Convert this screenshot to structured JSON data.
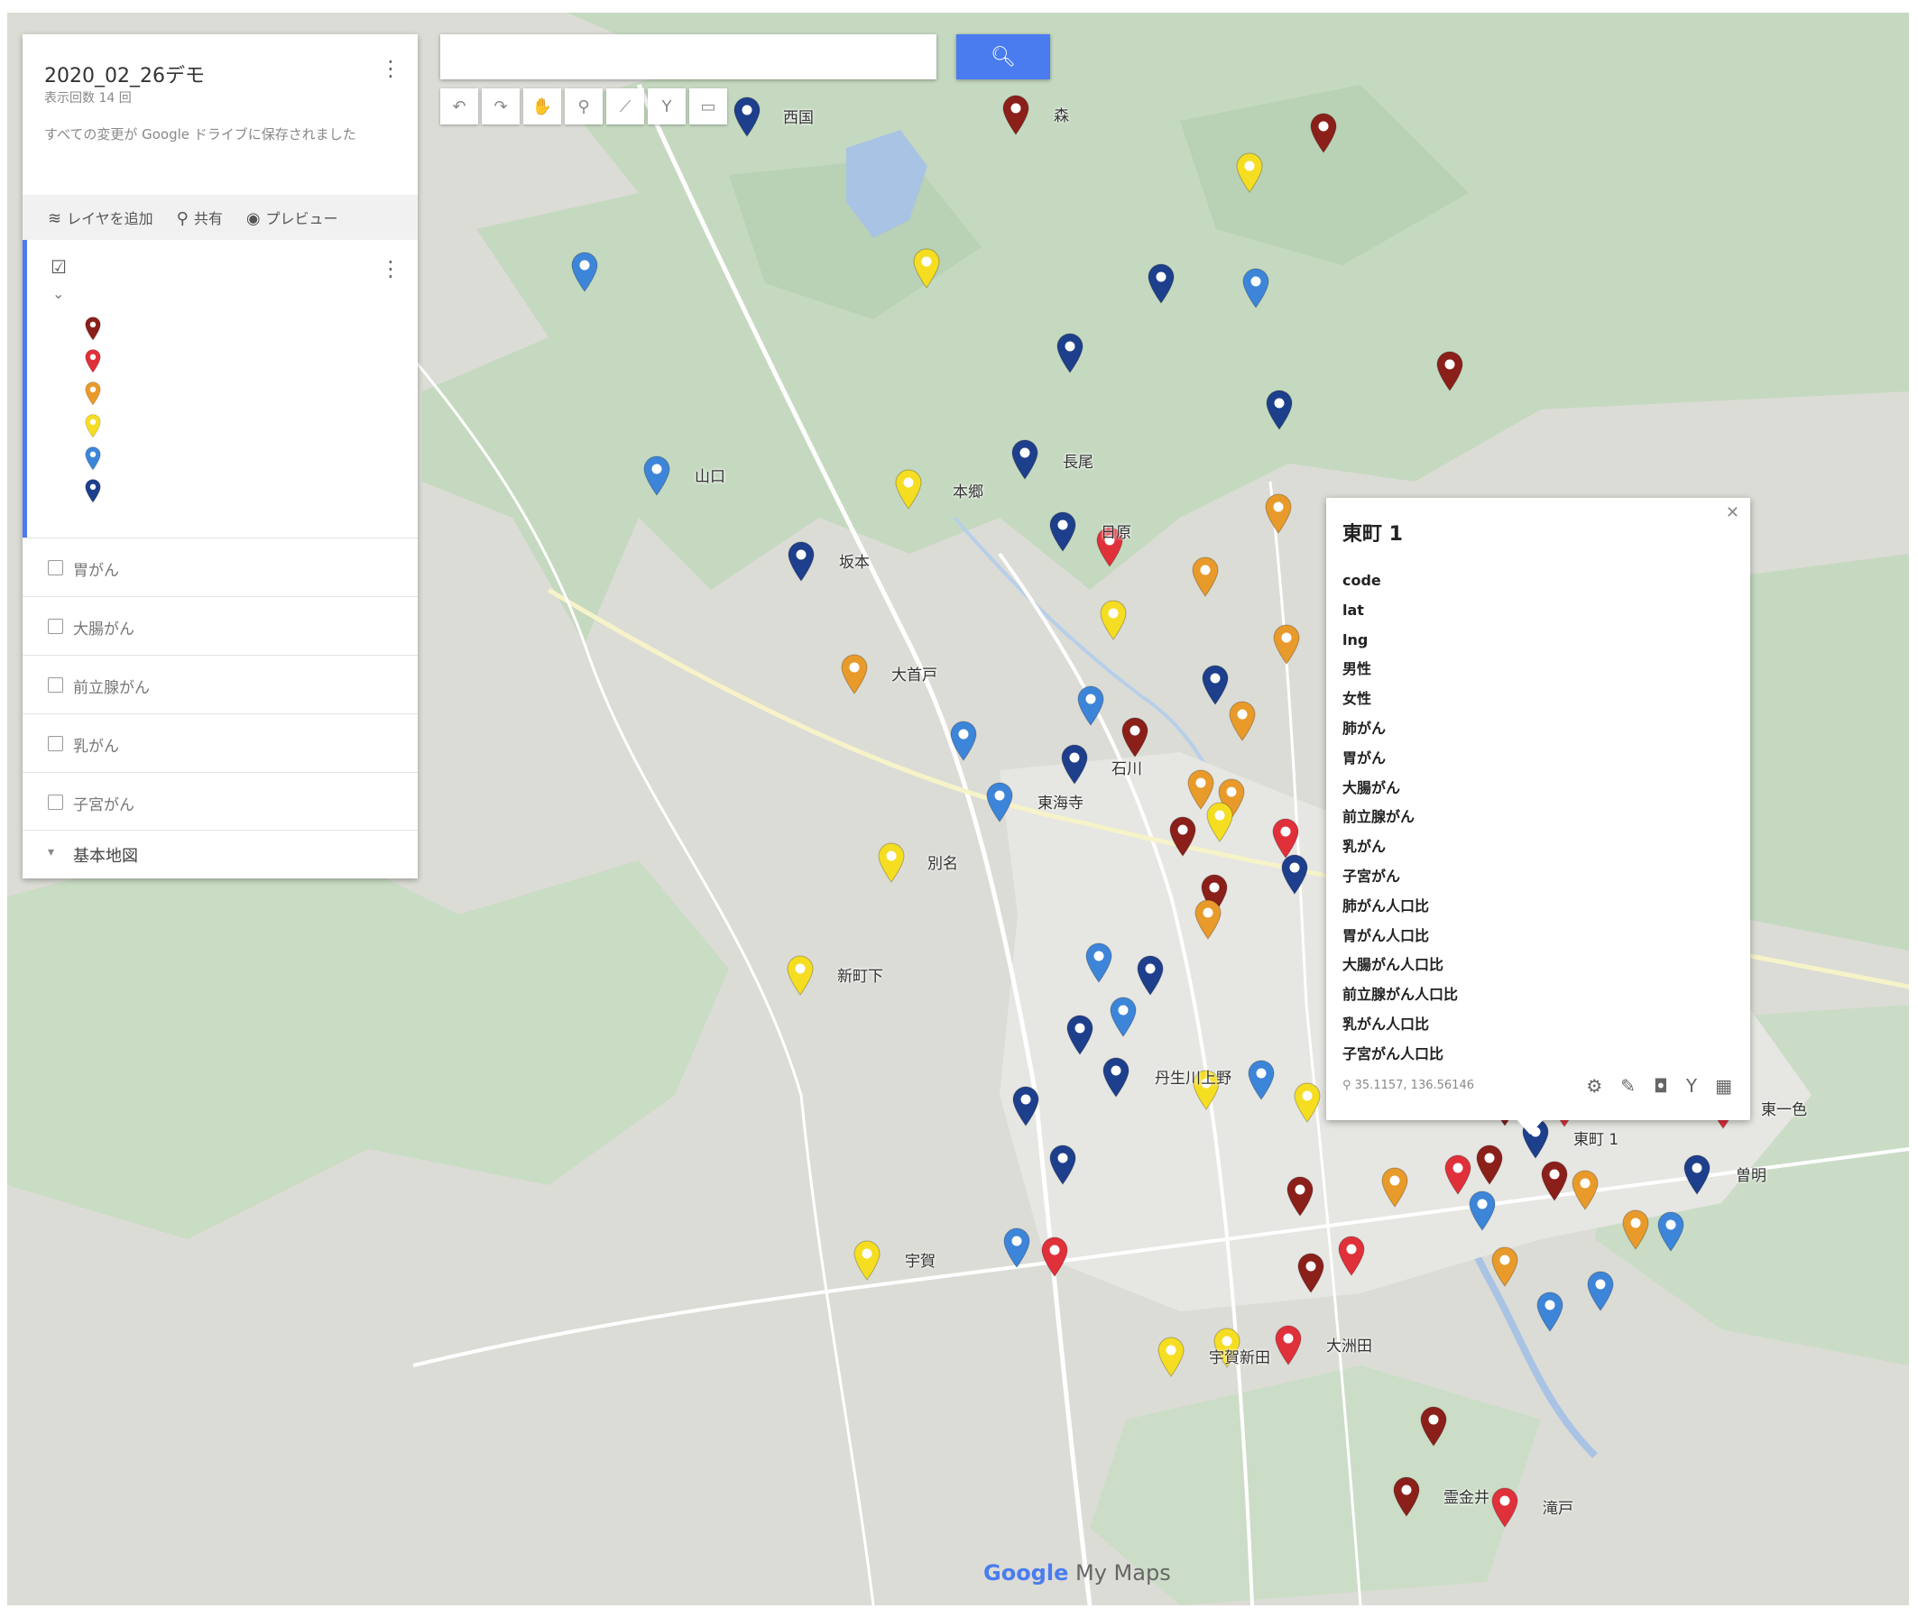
{
  "panel": {
    "map_title": "2020_02_26デモ",
    "views": "表示回数 14 回",
    "saved_status": "すべての変更が Google ドライブに保存されました",
    "add_layer": "レイヤを追加",
    "share": "共有",
    "preview": "プレビュー",
    "layers": [
      "胃がん",
      "大腸がん",
      "前立腺がん",
      "乳がん",
      "子宮がん"
    ],
    "base_map": "基本地図"
  },
  "legend_colors": [
    "#8b1f1a",
    "#e0303a",
    "#e89a2a",
    "#f5dd22",
    "#3d85d8",
    "#1d3f8c"
  ],
  "info": {
    "title": "東町 1",
    "fields": [
      "code",
      "lat",
      "lng",
      "男性",
      "女性",
      "肺がん",
      "胃がん",
      "大腸がん",
      "前立腺がん",
      "乳がん",
      "子宮がん",
      "肺がん人口比",
      "胃がん人口比",
      "大腸がん人口比",
      "前立腺がん人口比",
      "乳がん人口比",
      "子宮がん人口比"
    ],
    "coordinates": "35.1157, 136.56146"
  },
  "logo": {
    "google": "Google",
    "product": "My Maps"
  },
  "places": {
    "p1": "西国",
    "p2": "森",
    "p3": "山口",
    "p4": "本郷",
    "p5": "長尾",
    "p6": "日原",
    "p7": "坂本",
    "p8": "大首戸",
    "p9": "石川",
    "p10": "東海寺",
    "p11": "別名",
    "p12": "新町下",
    "p13": "丹生川上野",
    "p14": "東町 1",
    "p15": "東一色",
    "p16": "曽明",
    "p17": "宇賀",
    "p18": "宇賀新田",
    "p19": "大洲田",
    "p20": "霊金井",
    "p21": "滝戸"
  },
  "map_markers": [
    {
      "lat_label": "西国",
      "color": "#1d3f8c"
    },
    {
      "lat_label": "森",
      "color": "#8b1f1a"
    }
  ]
}
